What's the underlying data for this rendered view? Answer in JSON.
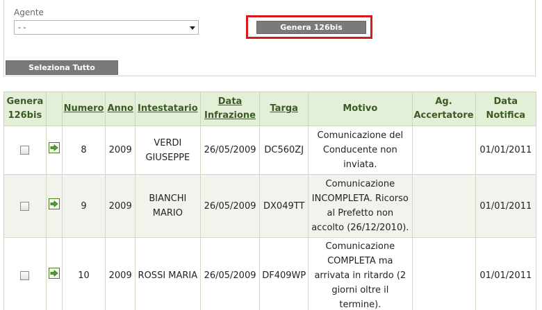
{
  "filter": {
    "agente_label": "Agente",
    "agente_value": "- -",
    "genera_button": "Genera 126bis",
    "seleziona_button": "Seleziona Tutto"
  },
  "table": {
    "headers": {
      "genera": "Genera 126bis",
      "numero": "Numero",
      "anno": "Anno",
      "intestatario": "Intestatario",
      "data_infrazione": "Data Infrazione",
      "targa": "Targa",
      "motivo": "Motivo",
      "ag_accertatore": "Ag. Accertatore",
      "data_notifica": "Data Notifica"
    },
    "rows": [
      {
        "numero": "8",
        "anno": "2009",
        "intestatario": "VERDI GIUSEPPE",
        "data_infrazione": "26/05/2009",
        "targa": "DC560ZJ",
        "motivo": "Comunicazione del Conducente non inviata.",
        "ag_accertatore": "",
        "data_notifica": "01/01/2011"
      },
      {
        "numero": "9",
        "anno": "2009",
        "intestatario": "BIANCHI MARIO",
        "data_infrazione": "26/05/2009",
        "targa": "DX049TT",
        "motivo": "Comunicazione INCOMPLETA. Ricorso al Prefetto non accolto (26/12/2010).",
        "ag_accertatore": "",
        "data_notifica": "01/01/2011"
      },
      {
        "numero": "10",
        "anno": "2009",
        "intestatario": "ROSSI MARIA",
        "data_infrazione": "26/05/2009",
        "targa": "DF409WP",
        "motivo": "Comunicazione COMPLETA ma arrivata in ritardo (2 giorni oltre il termine).",
        "ag_accertatore": "",
        "data_notifica": "01/01/2011"
      }
    ]
  },
  "icons": {
    "row_action": "arrow-go-icon",
    "colors": {
      "header_bg": "#e3efd7",
      "header_text": "#3b5a24",
      "highlight": "#d61a1a",
      "button_bg": "#7a7a7a"
    }
  }
}
